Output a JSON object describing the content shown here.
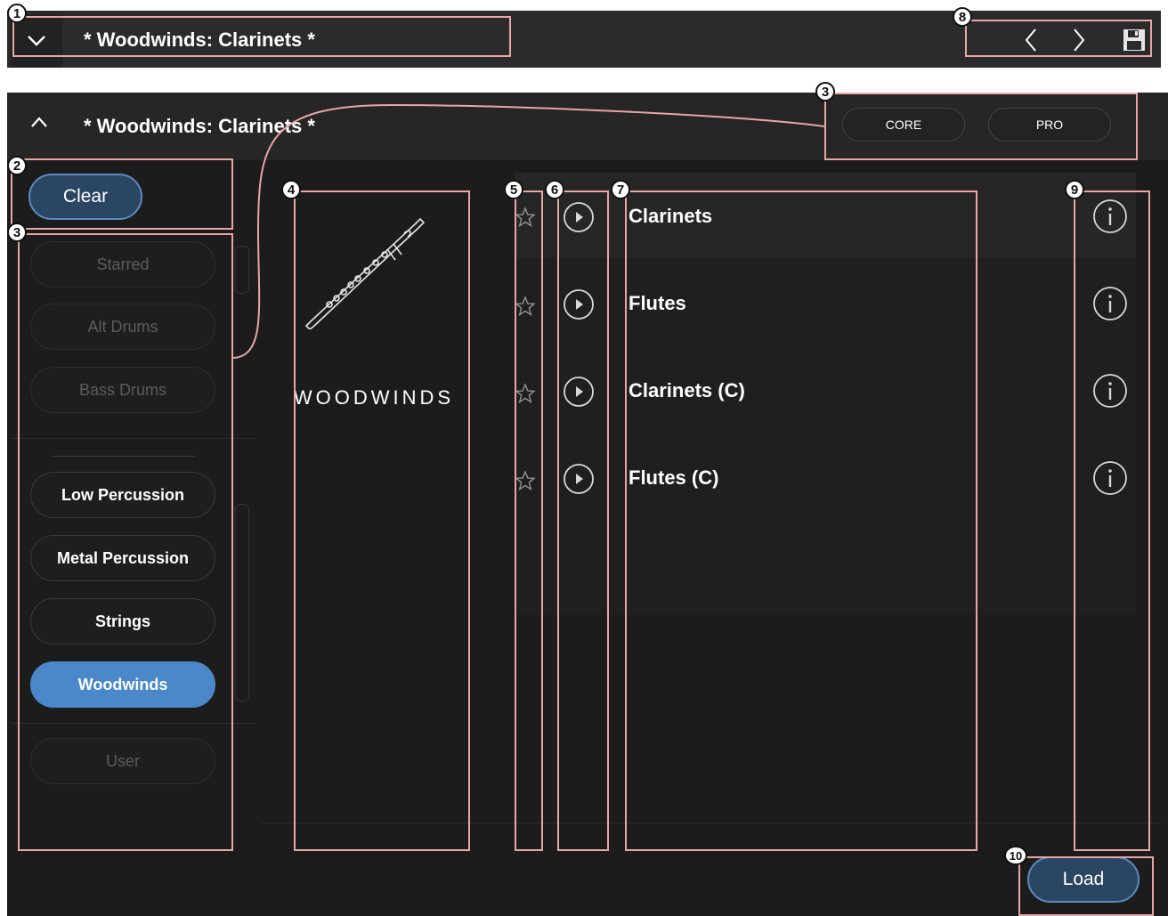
{
  "colors": {
    "accent": "#4a88c9",
    "annotation": "#e7a7a4",
    "panel_bg": "#1c1c1c"
  },
  "top_bar": {
    "title": "* Woodwinds: Clarinets *",
    "collapse_icon": "chevron-down-icon",
    "prev_icon": "chevron-left-icon",
    "next_icon": "chevron-right-icon",
    "save_icon": "save-icon"
  },
  "panel": {
    "title": "* Woodwinds: Clarinets *",
    "expand_icon": "chevron-up-icon",
    "editions": [
      "CORE",
      "PRO"
    ]
  },
  "sidebar": {
    "clear_label": "Clear",
    "categories_dim": [
      "Starred",
      "Alt Drums",
      "Bass Drums"
    ],
    "categories": [
      "Low Percussion",
      "Metal Percussion",
      "Strings",
      "Woodwinds"
    ],
    "active_category": "Woodwinds",
    "user_label": "User"
  },
  "category_display": {
    "label": "WOODWINDS",
    "image_icon": "clarinet-icon"
  },
  "presets": [
    {
      "name": "Clarinets",
      "selected": true
    },
    {
      "name": "Flutes",
      "selected": false
    },
    {
      "name": "Clarinets (C)",
      "selected": false
    },
    {
      "name": "Flutes (C)",
      "selected": false
    }
  ],
  "load_label": "Load",
  "annotations": [
    "1",
    "2",
    "3",
    "3",
    "4",
    "5",
    "6",
    "7",
    "8",
    "9",
    "10"
  ]
}
